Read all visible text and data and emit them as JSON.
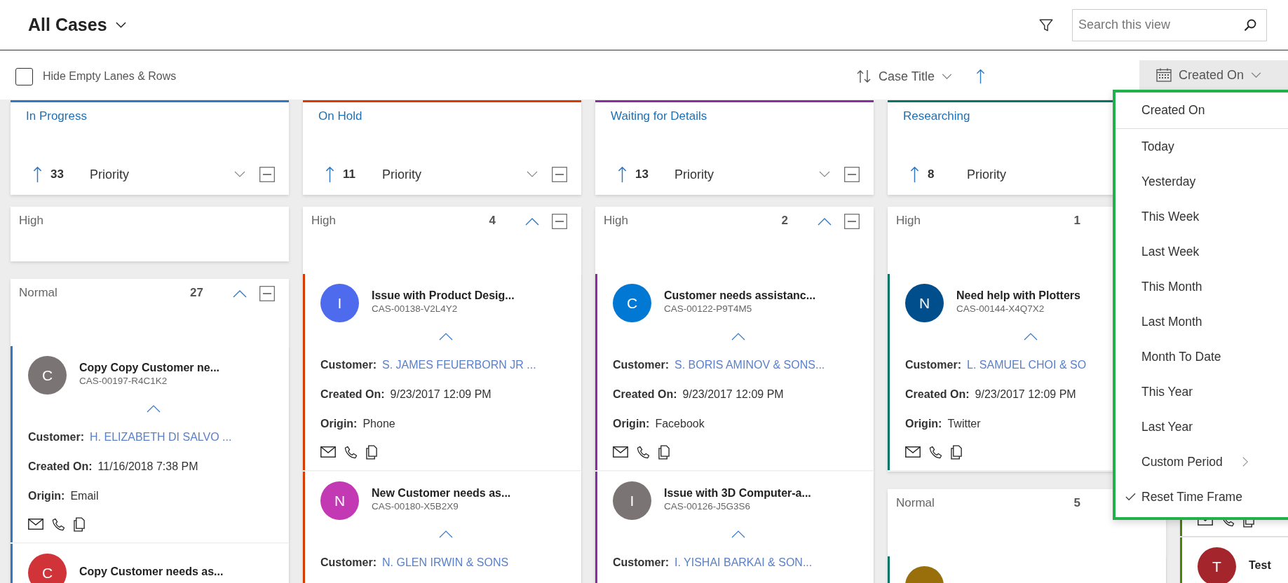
{
  "header": {
    "view_title": "All Cases",
    "search": {
      "placeholder": "Search this view"
    }
  },
  "toolbar": {
    "hide_empty": {
      "label": "Hide Empty Lanes & Rows",
      "checked": false
    },
    "sort": {
      "field": "Case Title"
    },
    "time_filter": {
      "label": "Created On"
    }
  },
  "columns": [
    {
      "title": "In Progress",
      "color": "#2f78c4",
      "count": "33",
      "group_by": "Priority",
      "controls": true,
      "lanes": [
        {
          "label": "High",
          "controls": false
        },
        {
          "label": "Normal",
          "count": "27",
          "controls": true,
          "cards": [
            {
              "avatar": "C",
              "color": "#7a7574",
              "title": "Copy Copy Customer ne...",
              "case_number": "CAS-00197-R4C1K2",
              "expanded": true,
              "fields": [
                {
                  "label": "Customer:",
                  "value": "H. ELIZABETH DI SALVO ...",
                  "kind": "link"
                },
                {
                  "label": "Created On:",
                  "value": "11/16/2018 7:38 PM",
                  "kind": "text"
                },
                {
                  "label": "Origin:",
                  "value": "Email",
                  "kind": "text"
                }
              ],
              "actions": true
            },
            {
              "avatar": "C",
              "color": "#d13438",
              "title": "Copy Customer needs as..."
            }
          ]
        }
      ]
    },
    {
      "title": "On Hold",
      "color": "#d83b01",
      "count": "11",
      "group_by": "Priority",
      "controls": true,
      "lanes": [
        {
          "label": "High",
          "count": "4",
          "controls": true,
          "cards": [
            {
              "avatar": "I",
              "color": "#4f6bed",
              "title": "Issue with Product Desig...",
              "case_number": "CAS-00138-V2L4Y2",
              "expanded": true,
              "fields": [
                {
                  "label": "Customer:",
                  "value": "S. JAMES FEUERBORN JR ...",
                  "kind": "link"
                },
                {
                  "label": "Created On:",
                  "value": "9/23/2017 12:09 PM",
                  "kind": "text"
                },
                {
                  "label": "Origin:",
                  "value": "Phone",
                  "kind": "text"
                }
              ],
              "actions": true
            },
            {
              "avatar": "N",
              "color": "#c239b3",
              "title": "New Customer needs as...",
              "case_number": "CAS-00180-X5B2X9",
              "expanded": true,
              "fields": [
                {
                  "label": "Customer:",
                  "value": "N. GLEN IRWIN & SONS",
                  "kind": "link"
                }
              ]
            }
          ]
        }
      ]
    },
    {
      "title": "Waiting for Details",
      "color": "#8a2da5",
      "count": "13",
      "group_by": "Priority",
      "controls": true,
      "lanes": [
        {
          "label": "High",
          "count": "2",
          "controls": true,
          "cards": [
            {
              "avatar": "C",
              "color": "#0078d4",
              "title": "Customer needs assistanc...",
              "case_number": "CAS-00122-P9T4M5",
              "expanded": true,
              "fields": [
                {
                  "label": "Customer:",
                  "value": "S. BORIS AMINOV & SONS...",
                  "kind": "link"
                },
                {
                  "label": "Created On:",
                  "value": "9/23/2017 12:09 PM",
                  "kind": "text"
                },
                {
                  "label": "Origin:",
                  "value": "Facebook",
                  "kind": "text"
                }
              ],
              "actions": true
            },
            {
              "avatar": "I",
              "color": "#7a7574",
              "title": "Issue with 3D Computer-a...",
              "case_number": "CAS-00126-J5G3S6",
              "expanded": true,
              "fields": [
                {
                  "label": "Customer:",
                  "value": "I. YISHAI BARKAI & SON...",
                  "kind": "link"
                }
              ]
            }
          ]
        }
      ]
    },
    {
      "title": "Researching",
      "color": "#077568",
      "count": "8",
      "group_by": "Priority",
      "controls": false,
      "lanes": [
        {
          "label": "High",
          "count": "1",
          "controls": false,
          "cards": [
            {
              "avatar": "N",
              "color": "#004e8c",
              "title": "Need help with Plotters",
              "case_number": "CAS-00144-X4Q7X2",
              "expanded": true,
              "fields": [
                {
                  "label": "Customer:",
                  "value": "L. SAMUEL CHOI & SO",
                  "kind": "link"
                },
                {
                  "label": "Created On:",
                  "value": "9/23/2017 12:09 PM",
                  "kind": "text"
                },
                {
                  "label": "Origin:",
                  "value": "Twitter",
                  "kind": "text"
                }
              ],
              "actions": true
            }
          ]
        },
        {
          "label": "Normal",
          "count": "5",
          "controls": false,
          "cards": [
            {
              "color": "#986f0b"
            }
          ]
        }
      ]
    },
    {
      "color": "#498205",
      "lanes": [
        {
          "cards": [
            {
              "actions": true
            },
            {
              "avatar": "T",
              "color": "#a4262c",
              "title": "Test"
            }
          ]
        }
      ]
    }
  ],
  "time_menu": {
    "heading": "Created On",
    "items": [
      {
        "label": "Today",
        "checked": false,
        "submenu": false
      },
      {
        "label": "Yesterday",
        "checked": false,
        "submenu": false
      },
      {
        "label": "This Week",
        "checked": false,
        "submenu": false
      },
      {
        "label": "Last Week",
        "checked": false,
        "submenu": false
      },
      {
        "label": "This Month",
        "checked": false,
        "submenu": false
      },
      {
        "label": "Last Month",
        "checked": false,
        "submenu": false
      },
      {
        "label": "Month To Date",
        "checked": false,
        "submenu": false
      },
      {
        "label": "This Year",
        "checked": false,
        "submenu": false
      },
      {
        "label": "Last Year",
        "checked": false,
        "submenu": false
      },
      {
        "label": "Custom Period",
        "checked": false,
        "submenu": true
      },
      {
        "label": "Reset Time Frame",
        "checked": true,
        "submenu": false
      }
    ]
  }
}
